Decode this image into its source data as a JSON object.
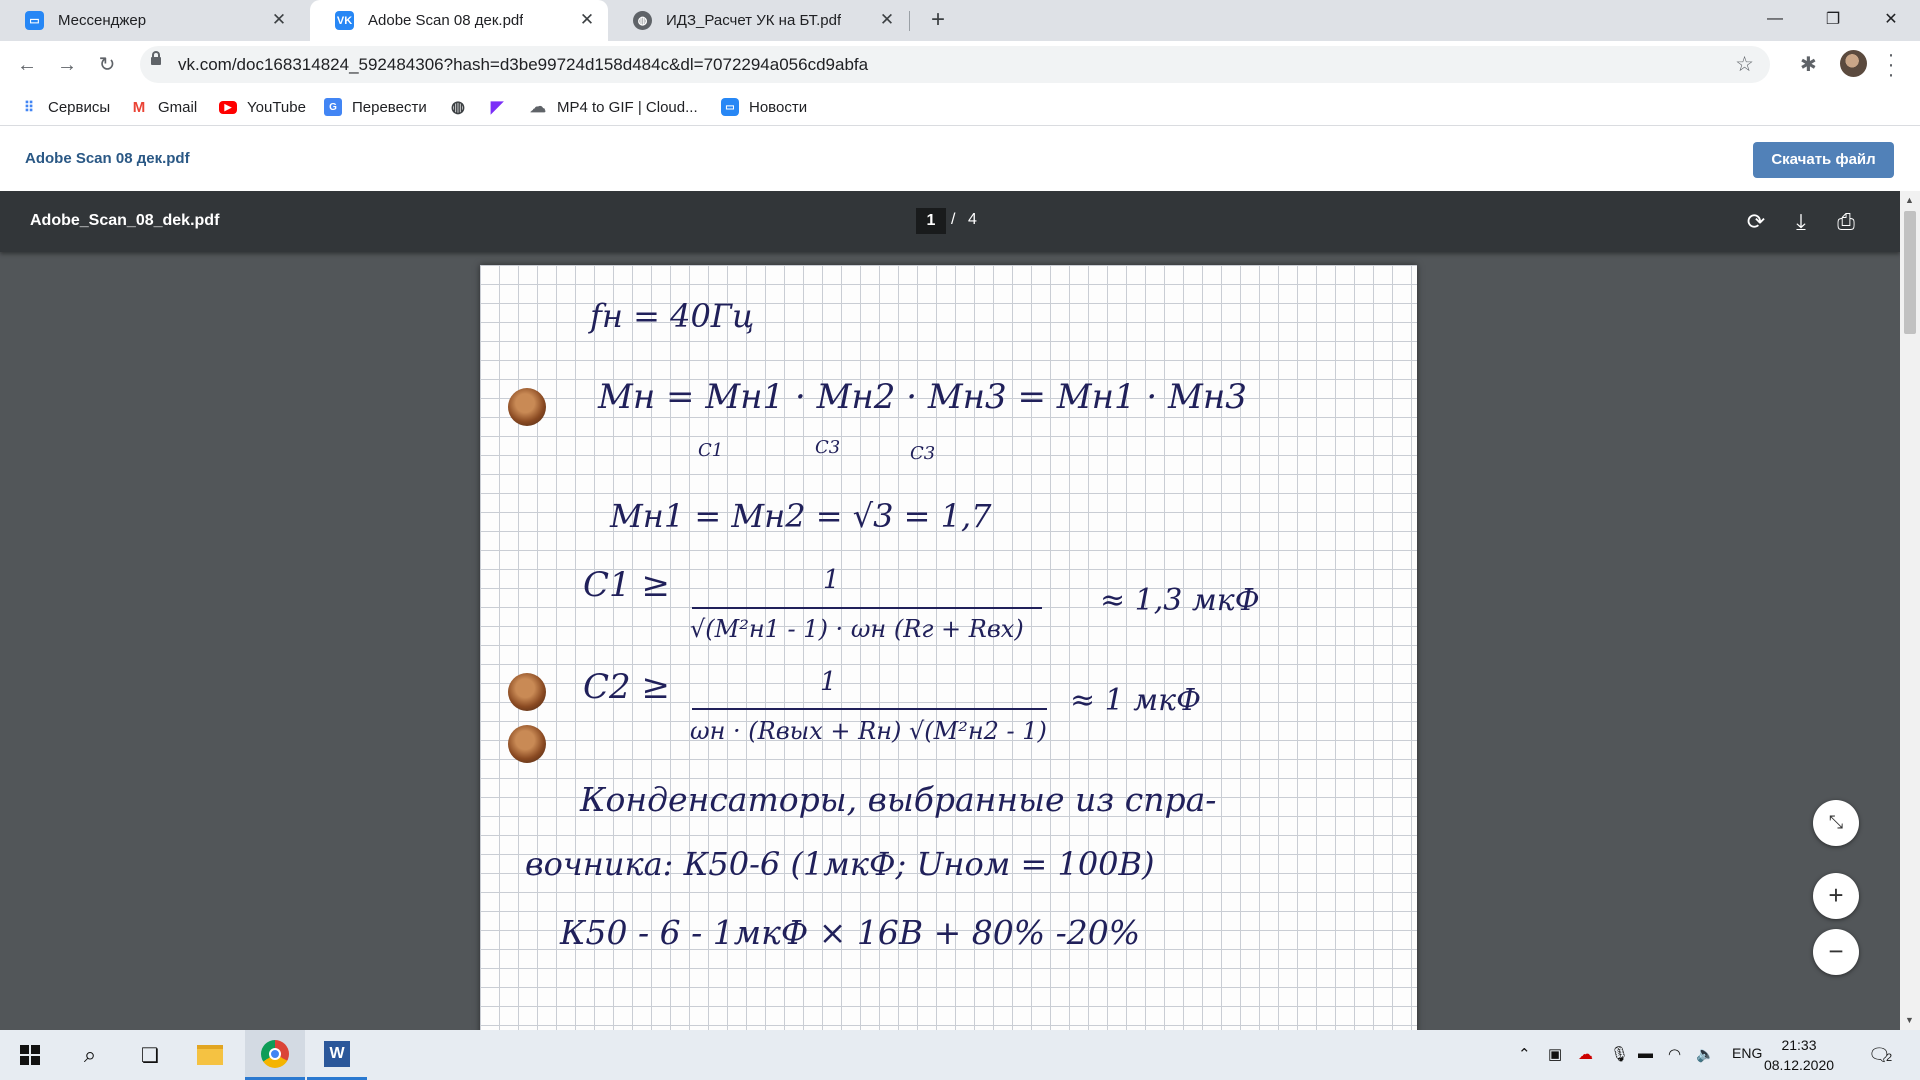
{
  "browser": {
    "tabs": [
      {
        "title": "Мессенджер",
        "icon": "messenger-icon",
        "icon_color": "#2787f5",
        "active": false
      },
      {
        "title": "Adobe Scan 08 дек.pdf",
        "icon": "vk-icon",
        "icon_color": "#2787f5",
        "active": true
      },
      {
        "title": "ИДЗ_Расчет УК на БТ.pdf",
        "icon": "globe-icon",
        "icon_color": "#5f6368",
        "active": false
      }
    ],
    "url": "vk.com/doc168314824_592484306?hash=d3be99724d158d484c&dl=7072294a056cd9abfa",
    "bookmarks": [
      {
        "label": "Сервисы",
        "icon": "apps-grid-icon"
      },
      {
        "label": "Gmail",
        "icon": "gmail-icon"
      },
      {
        "label": "YouTube",
        "icon": "youtube-icon"
      },
      {
        "label": "Перевести",
        "icon": "translate-icon"
      },
      {
        "label": "",
        "icon": "globe-icon"
      },
      {
        "label": "",
        "icon": "arrow-logo-icon"
      },
      {
        "label": "MP4 to GIF | Cloud...",
        "icon": "cloud-icon"
      },
      {
        "label": "Новости",
        "icon": "news-icon"
      }
    ]
  },
  "page": {
    "title": "Adobe Scan 08 дек.pdf",
    "download_label": "Скачать файл",
    "accent_color": "#5181b8"
  },
  "pdf": {
    "filename": "Adobe_Scan_08_dek.pdf",
    "current_page": "1",
    "separator": "/",
    "total_pages": "4",
    "content": {
      "line1": "fн = 40Гц",
      "line2": "Мн = Мн1 · Мн2 · Мн3 = Мн1 · Мн3",
      "line2_subs": [
        "C1",
        "C3",
        "C3"
      ],
      "line3": "Мн1 = Мн2 = √3 = 1,7",
      "c1_lhs": "C1 ≥",
      "c1_num": "1",
      "c1_den": "√(М²н1 - 1) · ωн (Rг + Rвх)",
      "c1_result": "≈ 1,3 мкФ",
      "c2_lhs": "C2 ≥",
      "c2_num": "1",
      "c2_den": "ωн · (Rвых + Rн) √(М²н2 - 1)",
      "c2_result": "≈ 1 мкФ",
      "text1": "Конденсаторы, выбранные из спра-",
      "text2": "вочника: К50-6 (1мкФ; Uном = 100В)",
      "text3": "К50 - 6 - 1мкФ × 16В + 80% -20%"
    }
  },
  "taskbar": {
    "tray_language": "ENG",
    "time": "21:33",
    "date": "08.12.2020",
    "notification_count": "2"
  }
}
